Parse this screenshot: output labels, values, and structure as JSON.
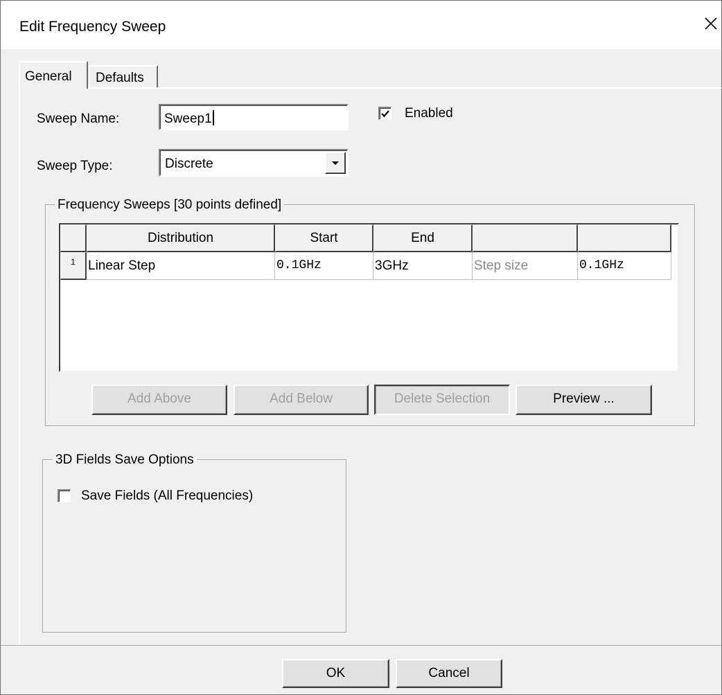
{
  "window": {
    "title": "Edit Frequency Sweep"
  },
  "tabs": [
    {
      "label": "General"
    },
    {
      "label": "Defaults"
    }
  ],
  "general": {
    "sweep_name_label": "Sweep Name:",
    "sweep_name_value": "Sweep1",
    "enabled_label": "Enabled",
    "enabled_checked": true,
    "sweep_type_label": "Sweep Type:",
    "sweep_type_value": "Discrete"
  },
  "frequency_sweeps": {
    "group_title": "Frequency Sweeps [30 points defined]",
    "columns": [
      "Distribution",
      "Start",
      "End",
      "",
      ""
    ],
    "rows": [
      {
        "row_number": "1",
        "distribution": "Linear Step",
        "start": "0.1GHz",
        "end": "3GHz",
        "param_label": "Step size",
        "param_value": "0.1GHz"
      }
    ],
    "buttons": {
      "add_above": "Add Above",
      "add_below": "Add Below",
      "delete_selection": "Delete Selection",
      "preview": "Preview ..."
    }
  },
  "fields_save": {
    "group_title": "3D Fields Save Options",
    "save_fields_label": "Save Fields (All Frequencies)",
    "save_fields_checked": false
  },
  "footer": {
    "ok": "OK",
    "cancel": "Cancel"
  }
}
